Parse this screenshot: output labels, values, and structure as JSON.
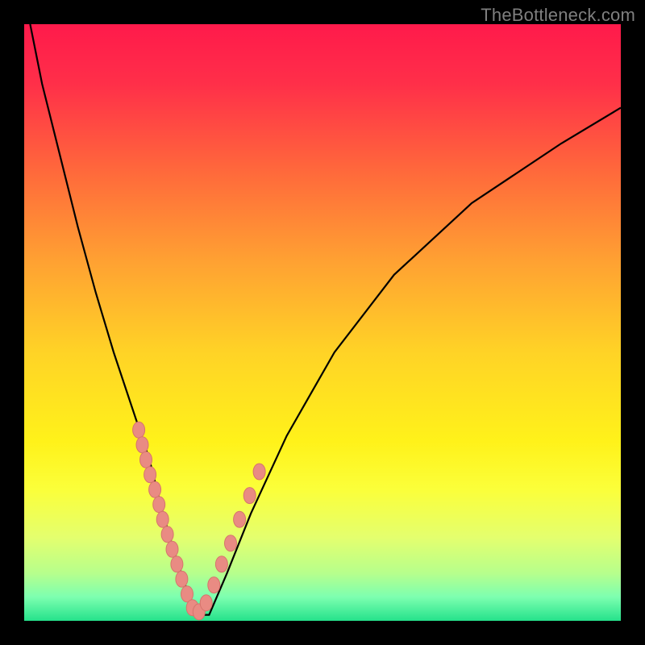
{
  "watermark": "TheBottleneck.com",
  "colors": {
    "gradient_stops": [
      {
        "offset": 0.0,
        "color": "#ff1a4b"
      },
      {
        "offset": 0.1,
        "color": "#ff2f49"
      },
      {
        "offset": 0.25,
        "color": "#ff6a3b"
      },
      {
        "offset": 0.4,
        "color": "#ffa232"
      },
      {
        "offset": 0.55,
        "color": "#ffd326"
      },
      {
        "offset": 0.7,
        "color": "#fff21a"
      },
      {
        "offset": 0.78,
        "color": "#fbff3a"
      },
      {
        "offset": 0.86,
        "color": "#e4ff6e"
      },
      {
        "offset": 0.92,
        "color": "#b7ff8c"
      },
      {
        "offset": 0.96,
        "color": "#7dffb0"
      },
      {
        "offset": 1.0,
        "color": "#25e28b"
      }
    ],
    "curve": "#000000",
    "dot_fill": "#e98b83",
    "dot_stroke": "#d6746c"
  },
  "chart_data": {
    "type": "line",
    "title": "",
    "xlabel": "",
    "ylabel": "",
    "xlim": [
      0,
      100
    ],
    "ylim": [
      0,
      100
    ],
    "grid": false,
    "series": [
      {
        "name": "bottleneck-curve",
        "x": [
          1,
          3,
          6,
          9,
          12,
          15,
          18,
          21,
          23,
          25,
          27,
          29,
          31,
          34,
          38,
          44,
          52,
          62,
          75,
          90,
          100
        ],
        "values": [
          100,
          90,
          78,
          66,
          55,
          45,
          36,
          27,
          19,
          12,
          6,
          1,
          1,
          8,
          18,
          31,
          45,
          58,
          70,
          80,
          86
        ]
      }
    ],
    "points": [
      {
        "name": "left-cluster",
        "x": [
          19.2,
          19.8,
          20.4,
          21.1,
          21.9,
          22.6,
          23.2,
          24.0,
          24.8,
          25.6,
          26.4,
          27.3,
          28.2
        ],
        "values": [
          32,
          29.5,
          27,
          24.5,
          22,
          19.5,
          17,
          14.5,
          12,
          9.5,
          7,
          4.5,
          2.2
        ]
      },
      {
        "name": "right-cluster",
        "x": [
          29.3,
          30.5,
          31.8,
          33.1,
          34.6,
          36.1,
          37.8,
          39.4
        ],
        "values": [
          1.5,
          3,
          6,
          9.5,
          13,
          17,
          21,
          25
        ]
      }
    ]
  }
}
